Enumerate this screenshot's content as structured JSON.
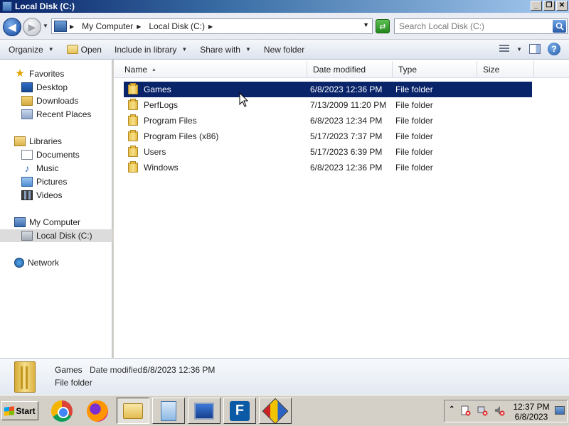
{
  "window": {
    "title": "Local Disk (C:)",
    "minimize": "_",
    "maximize": "❐",
    "close": "✕"
  },
  "address": {
    "crumbs": [
      {
        "label": "My Computer"
      },
      {
        "label": "Local Disk (C:)"
      }
    ],
    "search_placeholder": "Search Local Disk (C:)"
  },
  "toolbar": {
    "organize": "Organize",
    "open": "Open",
    "include_in_library": "Include in library",
    "share_with": "Share with",
    "new_folder": "New folder"
  },
  "nav": {
    "favorites": "Favorites",
    "favorites_items": [
      "Desktop",
      "Downloads",
      "Recent Places"
    ],
    "libraries": "Libraries",
    "libraries_items": [
      "Documents",
      "Music",
      "Pictures",
      "Videos"
    ],
    "computer": "My Computer",
    "computer_items": [
      "Local Disk (C:)"
    ],
    "network": "Network"
  },
  "columns": {
    "name": "Name",
    "date": "Date modified",
    "type": "Type",
    "size": "Size"
  },
  "files": [
    {
      "name": "Games",
      "date": "6/8/2023 12:36 PM",
      "type": "File folder",
      "size": ""
    },
    {
      "name": "PerfLogs",
      "date": "7/13/2009 11:20 PM",
      "type": "File folder",
      "size": ""
    },
    {
      "name": "Program Files",
      "date": "6/8/2023 12:34 PM",
      "type": "File folder",
      "size": ""
    },
    {
      "name": "Program Files (x86)",
      "date": "5/17/2023 7:37 PM",
      "type": "File folder",
      "size": ""
    },
    {
      "name": "Users",
      "date": "5/17/2023 6:39 PM",
      "type": "File folder",
      "size": ""
    },
    {
      "name": "Windows",
      "date": "6/8/2023 12:36 PM",
      "type": "File folder",
      "size": ""
    }
  ],
  "selected_index": 0,
  "details": {
    "name": "Games",
    "modified_label": "Date modified:",
    "modified_value": "6/8/2023 12:36 PM",
    "type": "File folder"
  },
  "taskbar": {
    "start": "Start",
    "apps": [
      "chrome-icon",
      "firefox-icon",
      "explorer-icon",
      "documents-icon",
      "remote-desktop-icon",
      "filezilla-icon",
      "tool-icon"
    ],
    "clock_time": "12:37 PM",
    "clock_date": "6/8/2023"
  },
  "colors": {
    "selection": "#0a246a",
    "titlebar": "#0a246a"
  }
}
